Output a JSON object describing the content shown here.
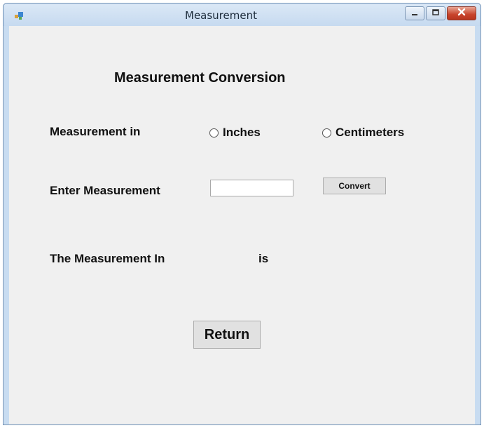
{
  "window": {
    "title": "Measurement",
    "icon": "app-form-icon",
    "controls": {
      "minimize_icon": "minimize-icon",
      "maximize_icon": "maximize-icon",
      "close_icon": "close-icon"
    }
  },
  "form": {
    "heading": "Measurement Conversion",
    "measurement_in_label": "Measurement in",
    "radio_options": [
      {
        "label": "Inches",
        "selected": false
      },
      {
        "label": "Centimeters",
        "selected": false
      }
    ],
    "enter_label": "Enter Measurement",
    "measurement_input": {
      "value": "",
      "placeholder": ""
    },
    "convert_button": "Convert",
    "result_prefix": "The Measurement In",
    "result_unit": "",
    "result_is": "is",
    "return_button": "Return"
  },
  "colors": {
    "client_bg": "#f0f0f0",
    "close_button": "#c7432b",
    "title_bar": "#c6daf0"
  }
}
